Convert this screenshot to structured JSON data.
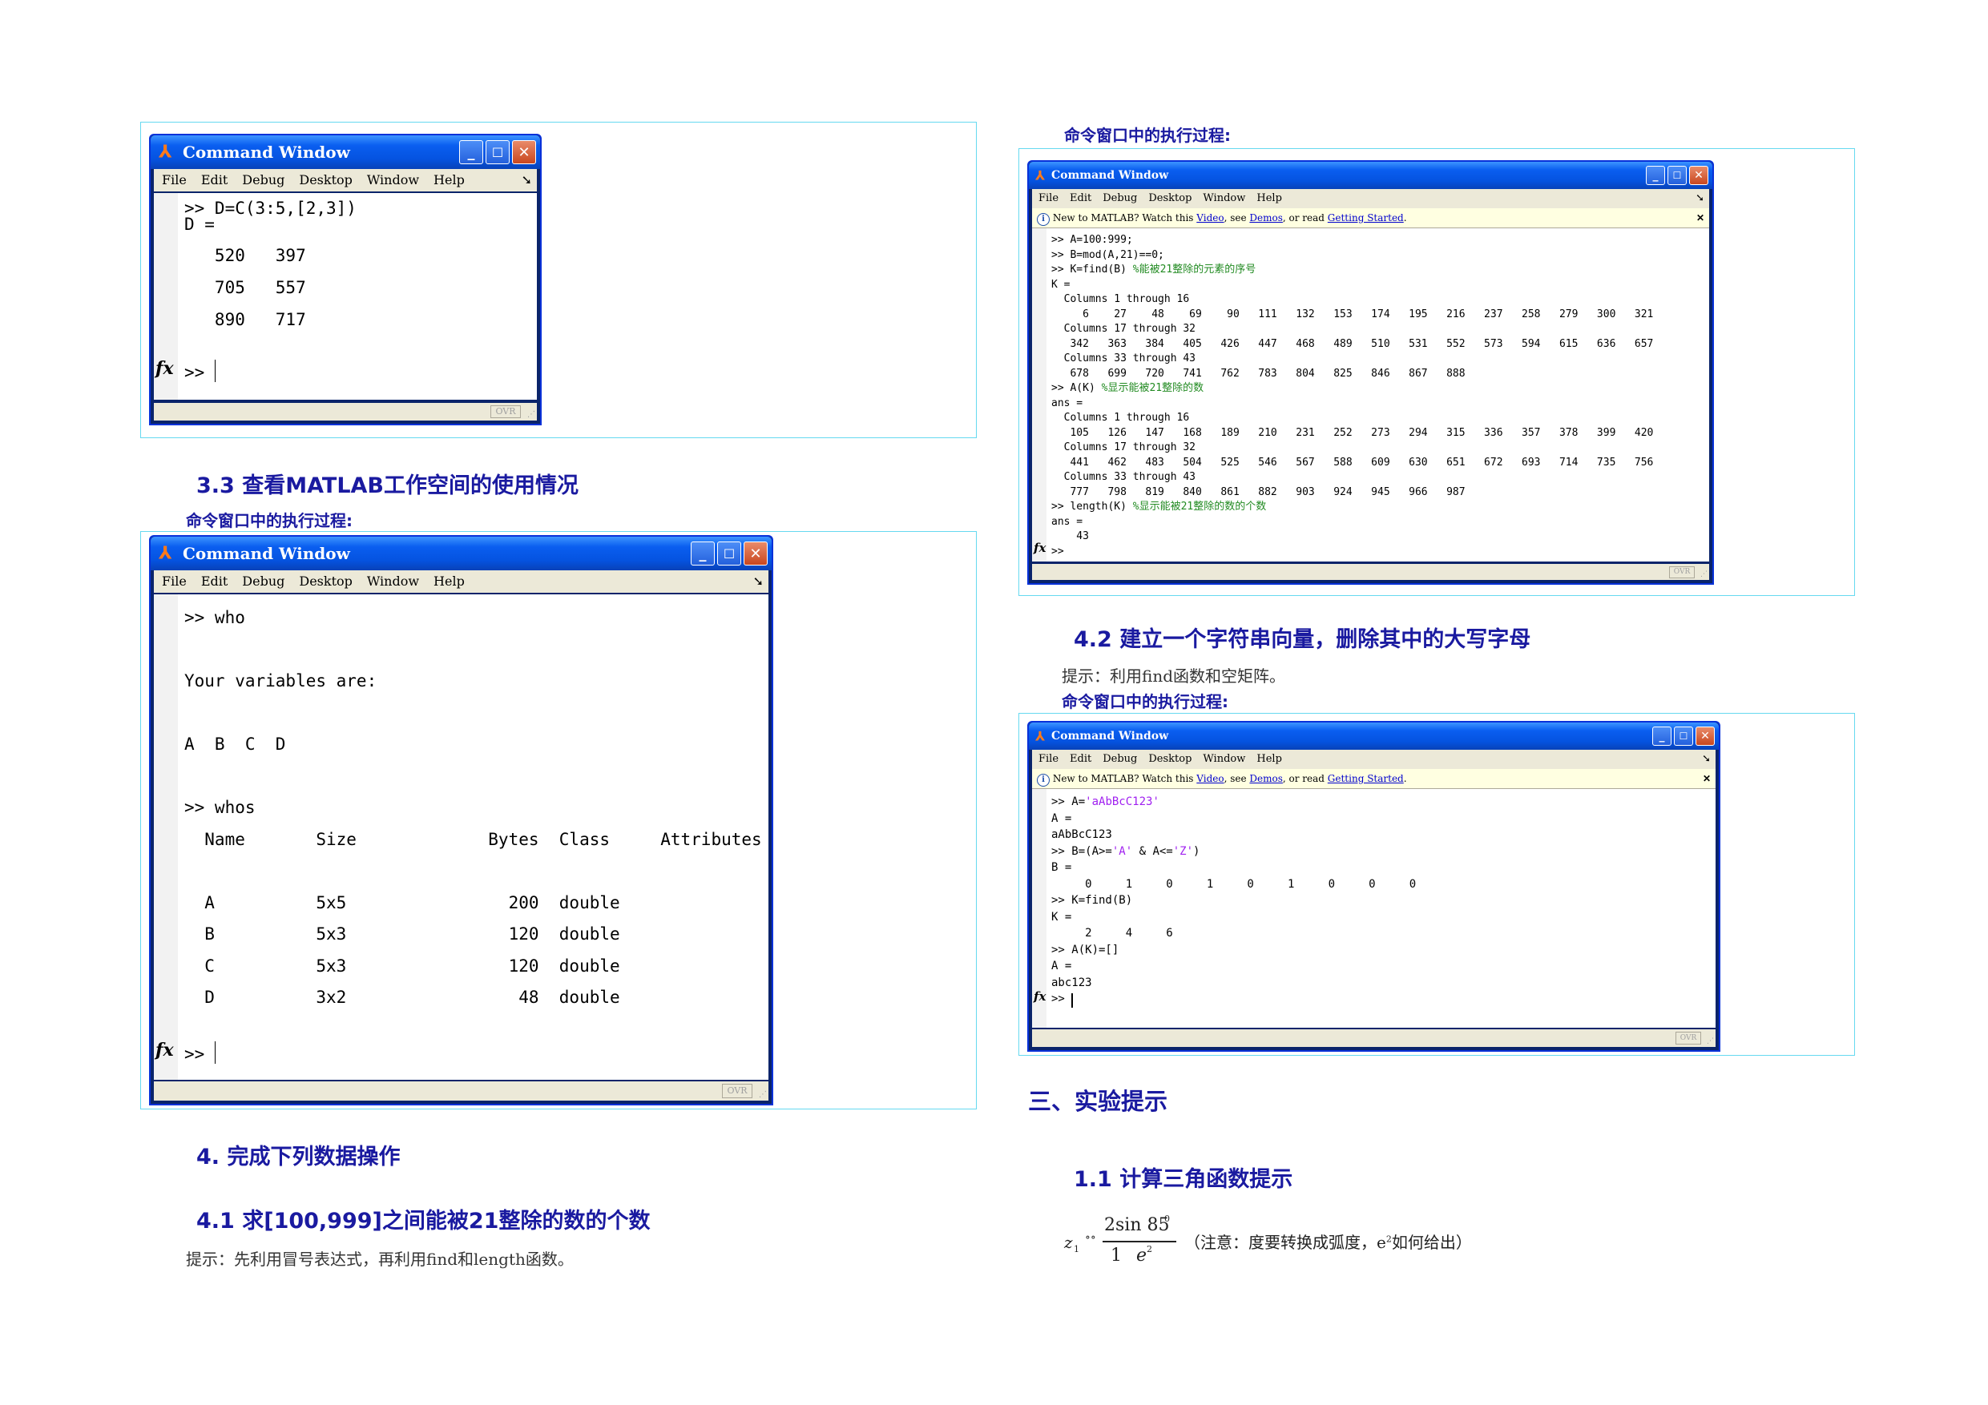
{
  "common": {
    "window_title": "Command Window",
    "menu": [
      "File",
      "Edit",
      "Debug",
      "Desktop",
      "Window",
      "Help"
    ],
    "ovr": "OVR",
    "notice": {
      "prefix": "New to MATLAB? Watch this ",
      "video": "Video",
      "mid": ", see ",
      "demos": "Demos",
      "mid2": ", or read ",
      "started": "Getting Started",
      "end": "."
    },
    "fx": "fx",
    "prompt": ">>"
  },
  "win1": {
    "lines": [
      ">> D=C(3:5,[2,3])",
      "D =",
      "",
      "   520   397",
      "",
      "   705   557",
      "",
      "   890   717",
      ""
    ]
  },
  "sec33": {
    "heading": "3.3 查看MATLAB工作空间的使用情况",
    "sub": "命令窗口中的执行过程:"
  },
  "win2": {
    "lines": [
      ">> who",
      "",
      "Your variables are:",
      "",
      "A  B  C  D",
      "",
      ">> whos",
      "  Name       Size             Bytes  Class     Attributes",
      "",
      "  A          5x5                200  double",
      "  B          5x3                120  double",
      "  C          5x3                120  double",
      "  D          3x2                 48  double",
      ""
    ]
  },
  "sec4": {
    "heading": "4.  完成下列数据操作"
  },
  "sec41": {
    "heading": "4.1 求[100,999]之间能被21整除的数的个数",
    "hint": "提示：先利用冒号表达式，再利用find和length函数。"
  },
  "right_top_sub": "命令窗口中的执行过程:",
  "win3": {
    "l1": ">> A=100:999;",
    "l2": ">> B=mod(A,21)==0;",
    "l3_code": ">> K=find(B) ",
    "l3_cmt": "%能被21整除的元素的序号",
    "l4": "K =",
    "k_cols1": "  Columns 1 through 16",
    "k_row1": "     6    27    48    69    90   111   132   153   174   195   216   237   258   279   300   321",
    "k_cols2": "  Columns 17 through 32",
    "k_row2": "   342   363   384   405   426   447   468   489   510   531   552   573   594   615   636   657",
    "k_cols3": "  Columns 33 through 43",
    "k_row3": "   678   699   720   741   762   783   804   825   846   867   888",
    "l5_code": ">> A(K) ",
    "l5_cmt": "%显示能被21整除的数",
    "l6": "ans =",
    "a_cols1": "  Columns 1 through 16",
    "a_row1": "   105   126   147   168   189   210   231   252   273   294   315   336   357   378   399   420",
    "a_cols2": "  Columns 17 through 32",
    "a_row2": "   441   462   483   504   525   546   567   588   609   630   651   672   693   714   735   756",
    "a_cols3": "  Columns 33 through 43",
    "a_row3": "   777   798   819   840   861   882   903   924   945   966   987",
    "l7_code": ">> length(K) ",
    "l7_cmt": "%显示能被21整除的数的个数",
    "l8": "ans =",
    "l9": "    43"
  },
  "sec42": {
    "heading": "4.2 建立一个字符串向量，删除其中的大写字母",
    "hint": "提示：利用find函数和空矩阵。",
    "sub": "命令窗口中的执行过程:"
  },
  "win4": {
    "l1a": ">> A=",
    "l1s": "'aAbBcC123'",
    "l2": "A =",
    "l3": "aAbBcC123",
    "l4a": ">> B=(A>=",
    "l4s1": "'A'",
    "l4b": " & A<=",
    "l4s2": "'Z'",
    "l4c": ")",
    "l5": "B =",
    "l6": "     0     1     0     1     0     1     0     0     0",
    "l7": ">> K=find(B)",
    "l8": "K =",
    "l9": "     2     4     6",
    "l10": ">> A(K)=[]",
    "l11": "A =",
    "l12": "abc123"
  },
  "sec3": {
    "heading": "三、实验提示"
  },
  "sec11": {
    "heading": "1.1 计算三角函数提示",
    "z": "z",
    "sub1": "1",
    "num": "2sin 85",
    "sup0": "0",
    "den1": "1",
    "den_e": "e",
    "sup2": "2",
    "note": "（注意：度要转换成弧度，e",
    "note_sup": "2",
    "note_end": "如何给出）"
  }
}
